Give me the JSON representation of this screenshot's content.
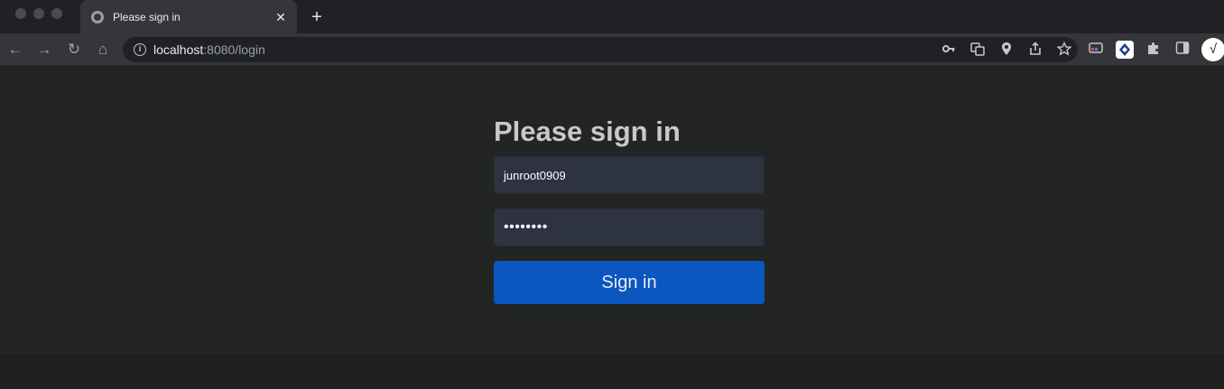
{
  "browser": {
    "tab_title": "Please sign in",
    "tab_close": "✕",
    "new_tab": "+",
    "url_host": "localhost",
    "url_rest": ":8080/login",
    "back": "←",
    "forward": "→",
    "reload": "↻",
    "home": "⌂",
    "info": "i",
    "omnibox_icons": [
      "key-icon",
      "translate-icon",
      "location-pin-icon",
      "share-icon",
      "bookmark-star-icon"
    ],
    "extension_icons": [
      "reading-list-icon",
      "extension-app-icon",
      "extensions-puzzle-icon",
      "side-panel-icon"
    ],
    "avatar": "√"
  },
  "login": {
    "heading": "Please sign in",
    "username_value": "junroot0909",
    "password_value": "••••••••",
    "submit_label": "Sign in"
  },
  "colors": {
    "page_bg": "#232424",
    "field_bg": "#2d3341",
    "button_bg": "#0b56bf"
  }
}
